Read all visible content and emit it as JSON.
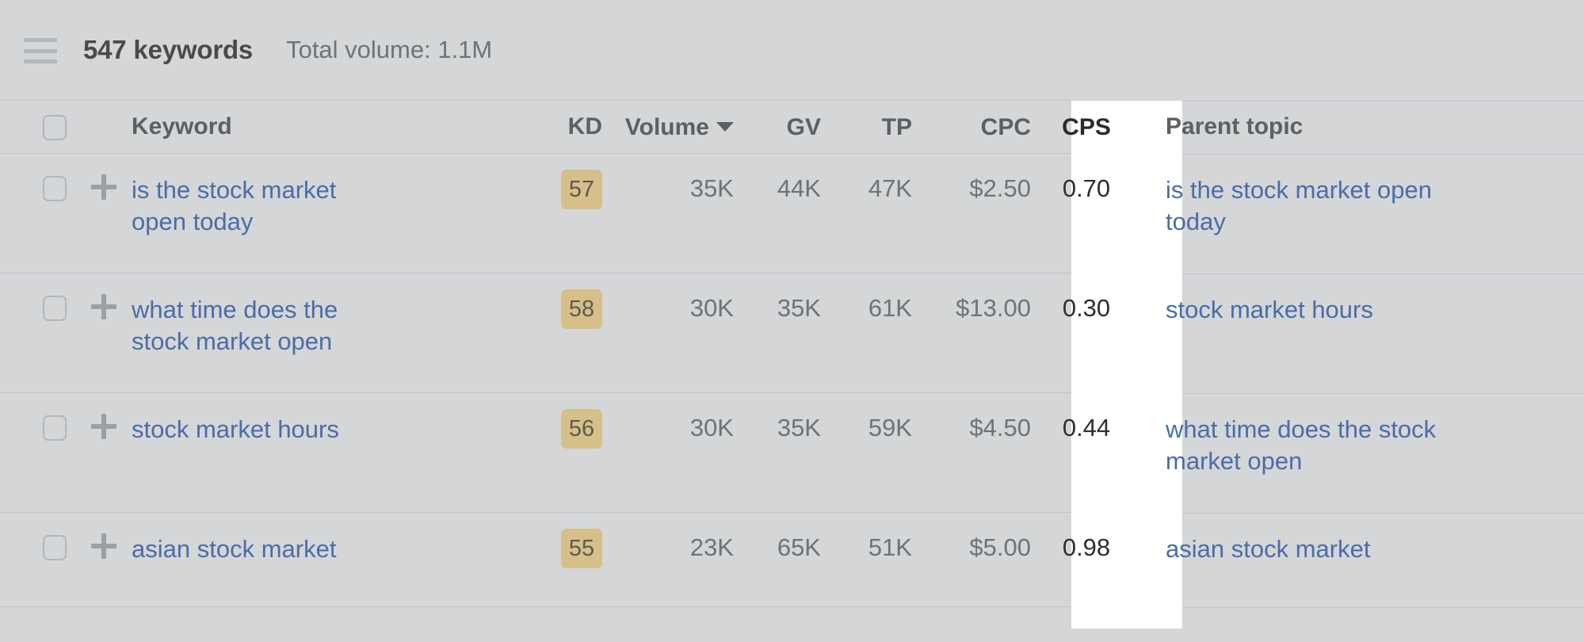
{
  "toolbar": {
    "menu_icon": "hamburger-icon",
    "keyword_count": "547 keywords",
    "total_volume": "Total volume: 1.1M"
  },
  "table": {
    "columns": {
      "keyword": "Keyword",
      "kd": "KD",
      "volume": "Volume",
      "gv": "GV",
      "tp": "TP",
      "cpc": "CPC",
      "cps": "CPS",
      "parent_topic": "Parent topic"
    },
    "sort": {
      "column": "Volume",
      "direction": "desc",
      "icon": "caret-down-icon"
    },
    "highlighted_column": "CPS",
    "rows": [
      {
        "keyword_line1": "is the stock market",
        "keyword_line2": "open today",
        "kd": "57",
        "volume": "35K",
        "gv": "44K",
        "tp": "47K",
        "cpc": "$2.50",
        "cps": "0.70",
        "parent_line1": "is the stock market open",
        "parent_line2": "today"
      },
      {
        "keyword_line1": "what time does the",
        "keyword_line2": "stock market open",
        "kd": "58",
        "volume": "30K",
        "gv": "35K",
        "tp": "61K",
        "cpc": "$13.00",
        "cps": "0.30",
        "parent_line1": "stock market hours",
        "parent_line2": ""
      },
      {
        "keyword_line1": "stock market hours",
        "keyword_line2": "",
        "kd": "56",
        "volume": "30K",
        "gv": "35K",
        "tp": "59K",
        "cpc": "$4.50",
        "cps": "0.44",
        "parent_line1": "what time does the stock",
        "parent_line2": "market open"
      },
      {
        "keyword_line1": "asian stock market",
        "keyword_line2": "",
        "kd": "55",
        "volume": "23K",
        "gv": "65K",
        "tp": "51K",
        "cpc": "$5.00",
        "cps": "0.98",
        "parent_line1": "asian stock market",
        "parent_line2": ""
      }
    ]
  },
  "colors": {
    "page_bg": "#d4d6d8",
    "highlight_bg": "#ffffff",
    "link": "#4a6da7",
    "kd_badge_bg": "#d7bf89",
    "muted_text": "#6e7376",
    "header_text": "#5c6063",
    "divider": "#c2c5c8"
  }
}
